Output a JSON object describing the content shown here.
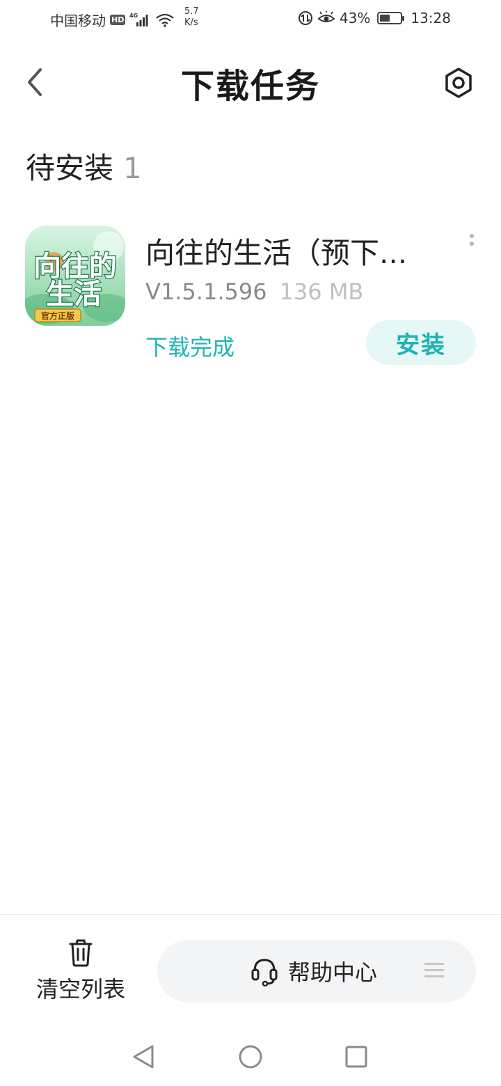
{
  "status_bar": {
    "carrier": "中国移动",
    "hd_badge": "HD",
    "network_type": "4G",
    "net_speed_value": "5.7",
    "net_speed_unit": "K/s",
    "battery_percent_text": "43%",
    "battery_level": 0.43,
    "time": "13:28"
  },
  "header": {
    "title": "下载任务"
  },
  "section": {
    "title": "待安装",
    "count": "1"
  },
  "task": {
    "app_name": "向往的生活（预下...",
    "version": "V1.5.1.596",
    "size": "136 MB",
    "status": "下载完成",
    "action_label": "安装",
    "icon_badge": "官方正版",
    "icon_title_line1": "向往的",
    "icon_title_line2": "生活"
  },
  "bottom_bar": {
    "clear_label": "清空列表",
    "help_label": "帮助中心"
  },
  "colors": {
    "accent": "#1fb5b5",
    "install_bg": "#e6f7f7",
    "pill_bg": "#f3f4f6"
  }
}
